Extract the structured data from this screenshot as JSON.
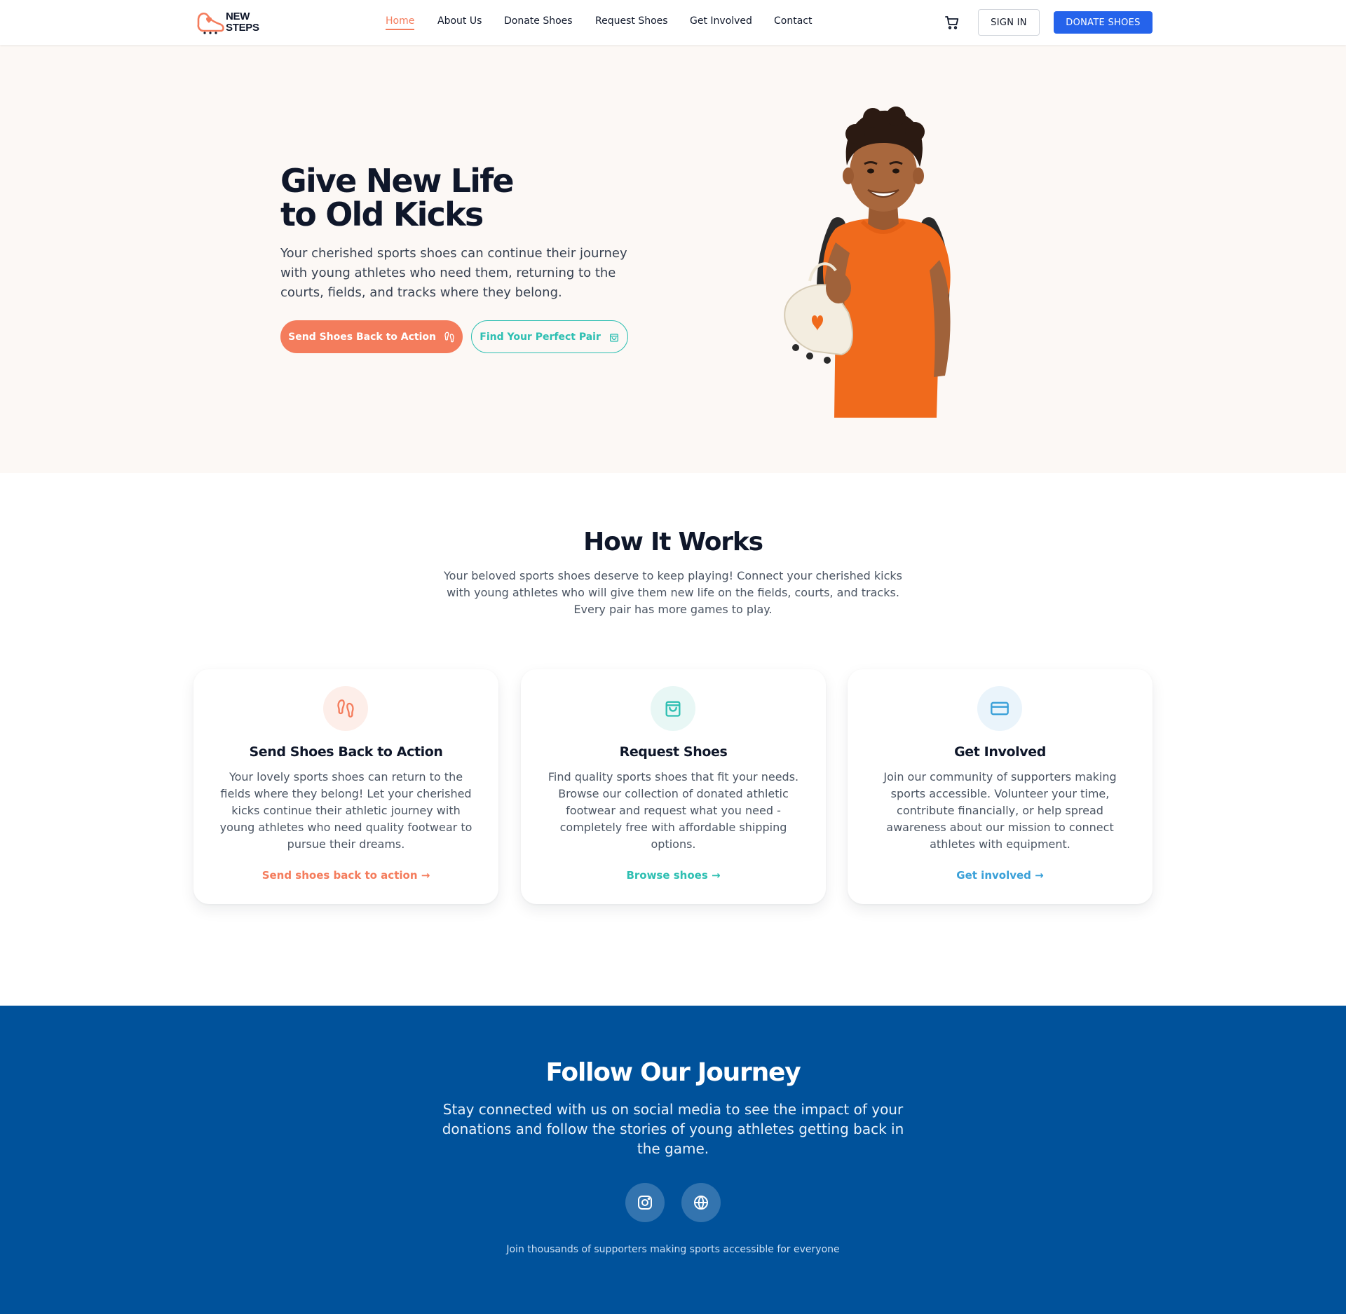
{
  "brand": {
    "line1": "NEW",
    "line2": "STEPS",
    "accent_color": "#f47c5c"
  },
  "nav": {
    "items": [
      {
        "label": "Home",
        "active": true
      },
      {
        "label": "About Us"
      },
      {
        "label": "Donate Shoes"
      },
      {
        "label": "Request Shoes"
      },
      {
        "label": "Get Involved"
      },
      {
        "label": "Contact"
      }
    ],
    "cart_icon": "shopping-cart-icon",
    "signin_label": "SIGN IN",
    "donate_label": "DONATE SHOES",
    "donate_color": "#2563eb"
  },
  "hero": {
    "title_line1": "Give New Life",
    "title_line2": "to Old Kicks",
    "description": "Your cherished sports shoes can continue their journey with young athletes who need them, returning to the courts, fields, and tracks where they belong.",
    "primary_cta": "Send Shoes Back to Action",
    "primary_icon": "footprints-icon",
    "secondary_cta": "Find Your Perfect Pair",
    "secondary_icon": "shopping-bag-icon",
    "primary_color": "#f47c5c",
    "secondary_color": "#2ebfb2"
  },
  "how": {
    "title": "How It Works",
    "subtitle": "Your beloved sports shoes deserve to keep playing! Connect your cherished kicks with young athletes who will give them new life on the fields, courts, and tracks. Every pair has more games to play.",
    "cards": [
      {
        "icon": "footprints-icon",
        "title": "Send Shoes Back to Action",
        "body": "Your lovely sports shoes can return to the fields where they belong! Let your cherished kicks continue their athletic journey with young athletes who need quality footwear to pursue their dreams.",
        "link": "Send shoes back to action →",
        "color": "#f47c5c"
      },
      {
        "icon": "shopping-bag-icon",
        "title": "Request Shoes",
        "body": "Find quality sports shoes that fit your needs. Browse our collection of donated athletic footwear and request what you need - completely free with affordable shipping options.",
        "link": "Browse shoes →",
        "color": "#2ebfb2"
      },
      {
        "icon": "credit-card-icon",
        "title": "Get Involved",
        "body": "Join our community of supporters making sports accessible. Volunteer your time, contribute financially, or help spread awareness about our mission to connect athletes with equipment.",
        "link": "Get involved →",
        "color": "#3aa0d8"
      }
    ]
  },
  "journey": {
    "title": "Follow Our Journey",
    "subtitle": "Stay connected with us on social media to see the impact of your donations and follow the stories of young athletes getting back in the game.",
    "social_icons": [
      "instagram-icon",
      "globe-icon"
    ],
    "footer_note": "Join thousands of supporters making sports accessible for everyone",
    "background": "#00529b"
  }
}
